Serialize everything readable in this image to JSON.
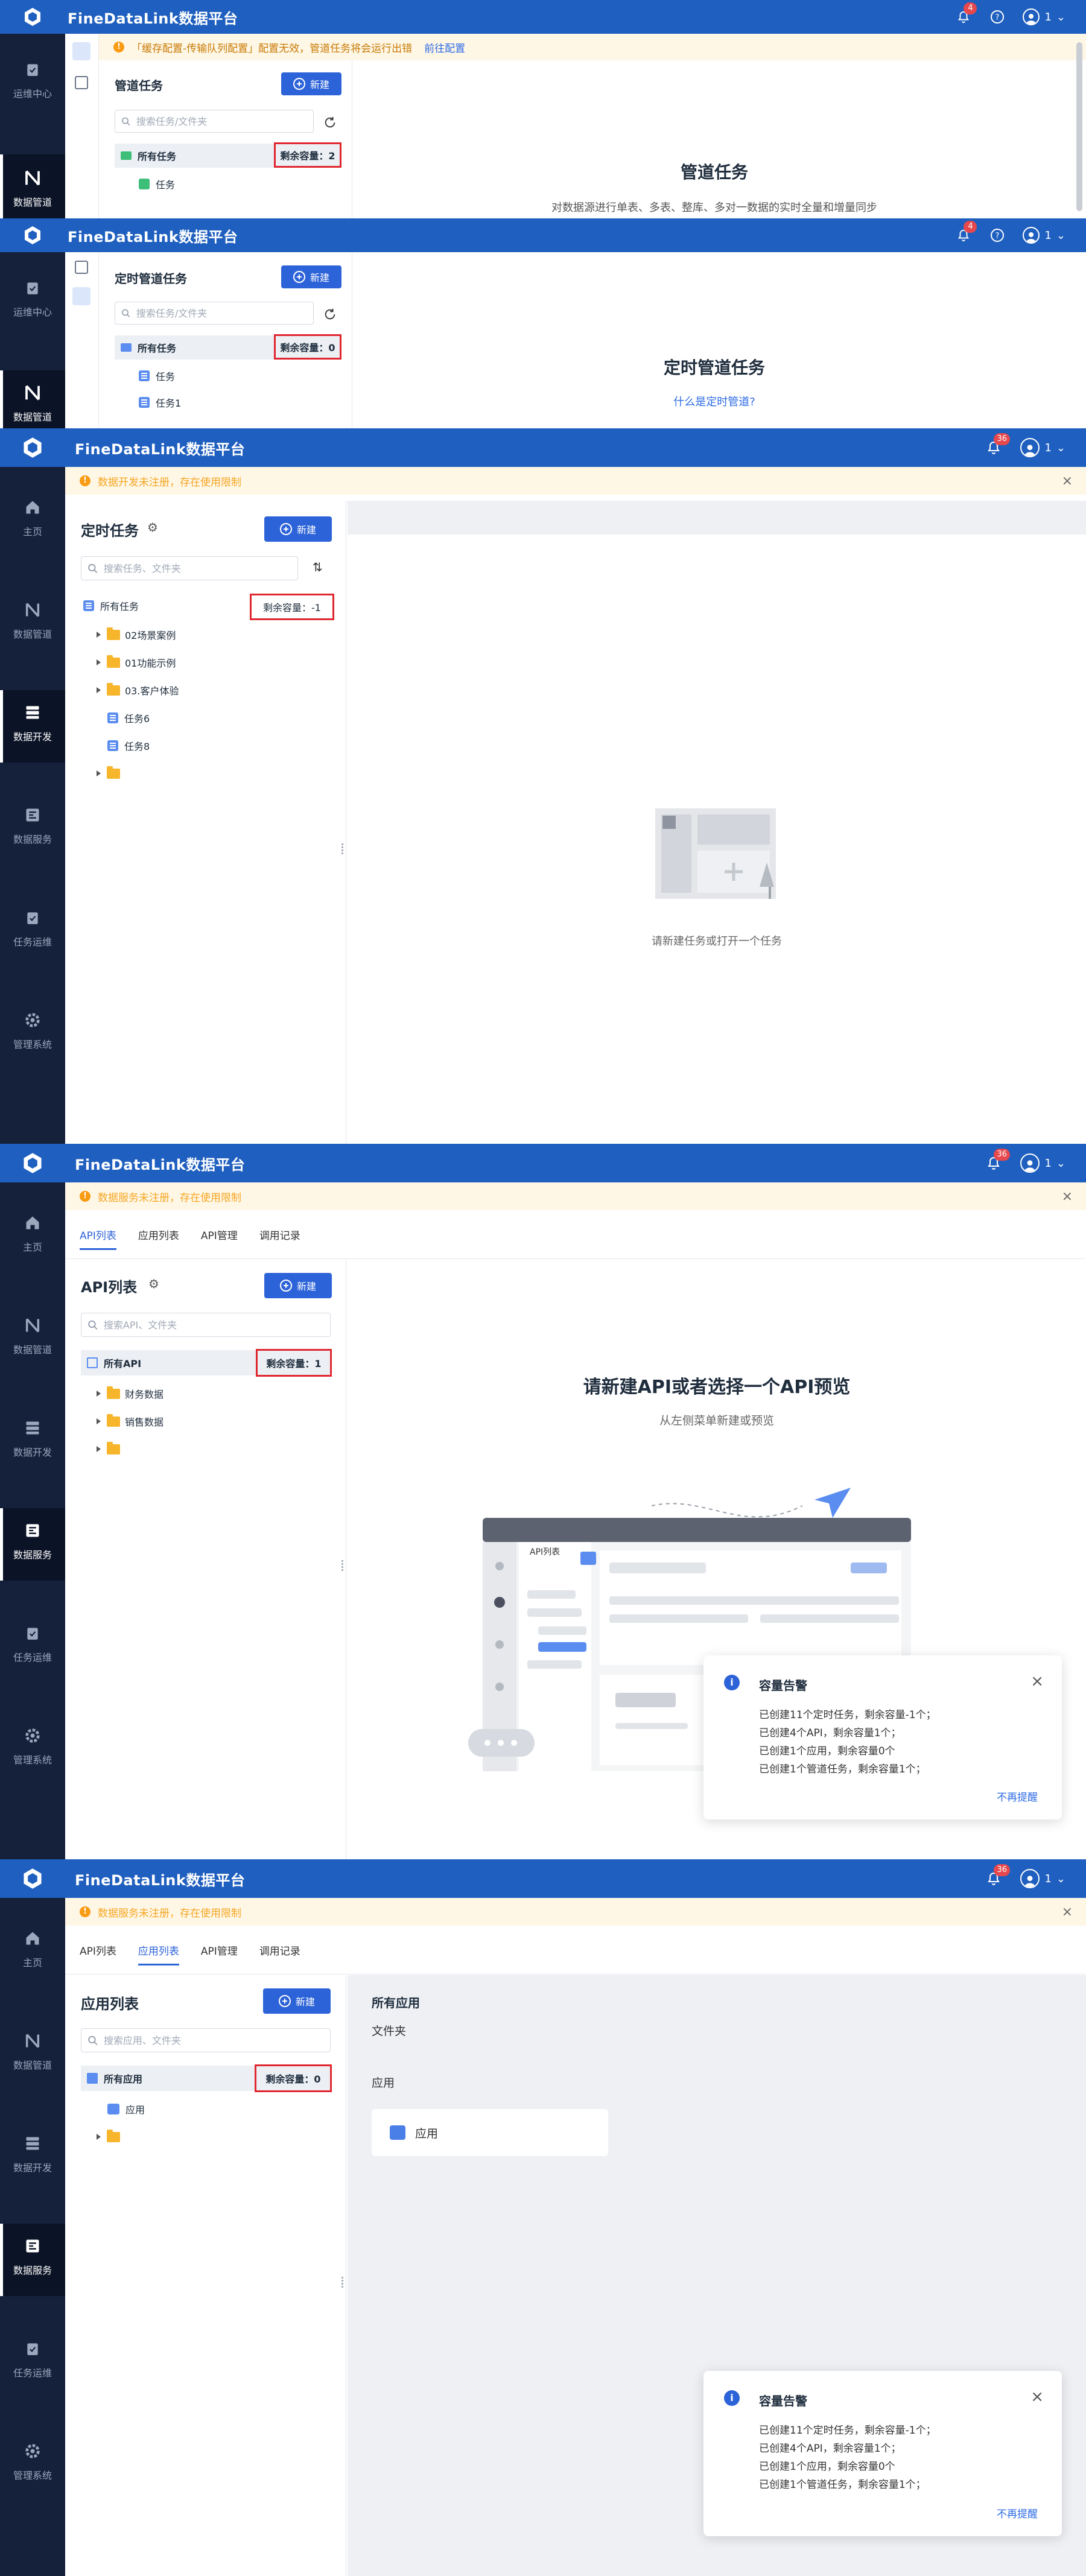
{
  "app": {
    "title": "FineDataLink数据平台"
  },
  "colors": {
    "topbar": "#1f5fbf",
    "sidebar": "#15203a",
    "accent": "#2d63d8",
    "highlight": "#e0262f"
  },
  "p1": {
    "badge": "4",
    "user": "1",
    "sidebar": [
      "运维中心",
      "数据管道"
    ],
    "notice": "「缓存配置-传输队列配置」配置无效，管道任务将会运行出错",
    "notice_link": "前往配置",
    "panel_title": "管道任务",
    "new_label": "新建",
    "search_placeholder": "搜索任务/文件夹",
    "all_label": "所有任务",
    "capacity": "剩余容量：2",
    "task": "任务",
    "main_title": "管道任务",
    "main_sub": "对数据源进行单表、多表、整库、多对一数据的实时全量和增量同步"
  },
  "p2": {
    "badge": "4",
    "user": "1",
    "sidebar": [
      "运维中心",
      "数据管道"
    ],
    "panel_title": "定时管道任务",
    "new_label": "新建",
    "search_placeholder": "搜索任务/文件夹",
    "all_label": "所有任务",
    "capacity": "剩余容量：0",
    "tasks": [
      "任务",
      "任务1"
    ],
    "main_title": "定时管道任务",
    "main_link": "什么是定时管道?"
  },
  "p3": {
    "badge": "36",
    "user": "1",
    "sidebar": [
      "主页",
      "数据管道",
      "数据开发",
      "数据服务",
      "任务运维",
      "管理系统"
    ],
    "notice": "数据开发未注册，存在使用限制",
    "panel_title": "定时任务",
    "new_label": "新建",
    "search_placeholder": "搜索任务、文件夹",
    "all_label": "所有任务",
    "capacity": "剩余容量：-1",
    "tree": [
      "02场景案例",
      "01功能示例",
      "03.客户体验",
      "任务6",
      "任务8"
    ],
    "empty_text": "请新建任务或打开一个任务"
  },
  "p4": {
    "badge": "36",
    "user": "1",
    "sidebar": [
      "主页",
      "数据管道",
      "数据开发",
      "数据服务",
      "任务运维",
      "管理系统"
    ],
    "notice": "数据服务未注册，存在使用限制",
    "tabs": [
      "API列表",
      "应用列表",
      "API管理",
      "调用记录"
    ],
    "panel_title": "API列表",
    "new_label": "新建",
    "search_placeholder": "搜索API、文件夹",
    "all_label": "所有API",
    "capacity": "剩余容量：1",
    "tree": [
      "财务数据",
      "销售数据"
    ],
    "main_title": "请新建API或者选择一个API预览",
    "main_sub": "从左侧菜单新建或预览",
    "illus_label": "API列表",
    "toast": {
      "title": "容量告警",
      "lines": [
        "已创建11个定时任务，剩余容量-1个；",
        "已创建4个API，剩余容量1个；",
        "已创建1个应用，剩余容量0个",
        "已创建1个管道任务，剩余容量1个；"
      ],
      "dismiss": "不再提醒"
    }
  },
  "p5": {
    "badge": "36",
    "user": "1",
    "sidebar": [
      "主页",
      "数据管道",
      "数据开发",
      "数据服务",
      "任务运维",
      "管理系统"
    ],
    "notice": "数据服务未注册，存在使用限制",
    "tabs": [
      "API列表",
      "应用列表",
      "API管理",
      "调用记录"
    ],
    "panel_title": "应用列表",
    "new_label": "新建",
    "search_placeholder": "搜索应用、文件夹",
    "all_label": "所有应用",
    "capacity": "剩余容量：0",
    "tree": [
      "应用"
    ],
    "main_heading": "所有应用",
    "folder_label": "文件夹",
    "app_label": "应用",
    "card_label": "应用",
    "toast": {
      "title": "容量告警",
      "lines": [
        "已创建11个定时任务，剩余容量-1个；",
        "已创建4个API，剩余容量1个；",
        "已创建1个应用，剩余容量0个",
        "已创建1个管道任务，剩余容量1个；"
      ],
      "dismiss": "不再提醒"
    }
  }
}
